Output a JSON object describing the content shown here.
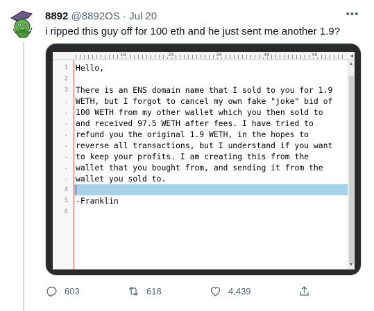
{
  "tweet": {
    "author_name": "8892",
    "author_handle": "@8892OS",
    "separator": "·",
    "date": "Jul 20",
    "more_icon": "ellipsis-icon",
    "text": "i ripped this guy off for 100 eth and he just sent me another 1.9?"
  },
  "editor": {
    "ruler_numbers": [
      "10",
      "20",
      "30",
      "40",
      "50"
    ],
    "lines": [
      {
        "num": "1",
        "text": "Hello,"
      },
      {
        "num": "2",
        "text": ""
      },
      {
        "num": "3",
        "text": "There is an ENS domain name that I sold to you for 1.9"
      },
      {
        "num": ".",
        "text": "WETH, but I forgot to cancel my own fake \"joke\" bid of"
      },
      {
        "num": ".",
        "text": "100 WETH from my other wallet which you then sold to"
      },
      {
        "num": ".",
        "text": "and received 97.5 WETH after fees. I have tried to"
      },
      {
        "num": ".",
        "text": "refund you the original 1.9 WETH, in the hopes to"
      },
      {
        "num": ".",
        "text": "reverse all transactions, but I understand if you want"
      },
      {
        "num": ".",
        "text": "to keep your profits. I am creating this from the"
      },
      {
        "num": ".",
        "text": "wallet that you bought from, and sending it from the"
      },
      {
        "num": ".",
        "text": "wallet you sold to."
      },
      {
        "num": "4",
        "text": ""
      },
      {
        "num": "5",
        "text": "-Franklin"
      },
      {
        "num": "6",
        "text": ""
      }
    ]
  },
  "actions": {
    "reply": {
      "icon": "reply-icon",
      "count": "603"
    },
    "retweet": {
      "icon": "retweet-icon",
      "count": "618"
    },
    "like": {
      "icon": "heart-icon",
      "count": "4,439"
    },
    "share": {
      "icon": "share-icon"
    }
  },
  "colors": {
    "accent_highlight": "#a8d3ec",
    "muted_text": "#536471",
    "text": "#0f1419"
  }
}
